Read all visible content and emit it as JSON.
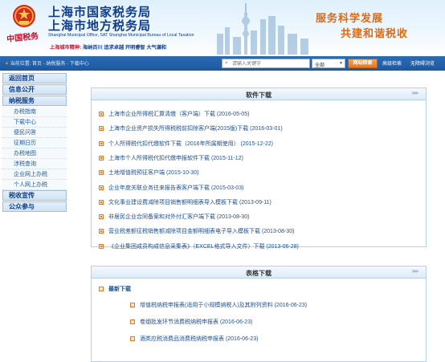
{
  "header": {
    "title_line1": "上海市国家税务局",
    "title_line2": "上海市地方税务局",
    "title_en": "Shanghai Municipal Office, SAT  Shanghai Municipal Bureau of Local Taxation",
    "spirit_label": "上海城市精神:",
    "spirit_text": "海纳百川  追求卓越  开明睿智  大气谦和",
    "seal_text": "中国税务",
    "slogan1": "服务科学发展",
    "slogan2": "共建和谐税收"
  },
  "toolbar": {
    "breadcrumb": "当前位置: 首页 - 纳税服务 - 下载中心",
    "search_placeholder": "请输入关键字",
    "scope_value": "全部",
    "search_button": "网站检索",
    "advanced_search": "高级检索",
    "accessibility": "无障碍浏览"
  },
  "sidebar": {
    "items": [
      {
        "label": "返回首页",
        "level": "main"
      },
      {
        "label": "信息公开",
        "level": "main"
      },
      {
        "label": "纳税服务",
        "level": "main"
      },
      {
        "label": "办税指南",
        "level": "sub"
      },
      {
        "label": "下载中心",
        "level": "sub"
      },
      {
        "label": "便民问答",
        "level": "sub"
      },
      {
        "label": "征期日历",
        "level": "sub"
      },
      {
        "label": "办税地图",
        "level": "sub"
      },
      {
        "label": "涉税查询",
        "level": "sub"
      },
      {
        "label": "企业网上办税",
        "level": "sub"
      },
      {
        "label": "个人网上办税",
        "level": "sub"
      },
      {
        "label": "税收宣传",
        "level": "main"
      },
      {
        "label": "公众参与",
        "level": "main"
      }
    ]
  },
  "software": {
    "title": "软件下载",
    "more": ">>>",
    "items": [
      "上海市企业所得税汇算清缴（客户端）下载 (2016-05-05)",
      "上海市企业资产损失所得税税前扣除客户端(2015版)下载 (2016-03-01)",
      "个人所得税代扣代缴软件下载（2016年所属期使用） (2015-12-22)",
      "上海市个人所得税代扣代缴申报软件下载 (2015-11-12)",
      "土地增值税预征客户端 (2015-10-30)",
      "企业年度关联业务往来报告表客户端下载 (2015-03-03)",
      "文化事业建设费减除项目销售额明细表导入模板下载 (2013-09-11)",
      "非居民企业合同备案和对外付汇客户端下载 (2013-08-30)",
      "营业税差额征税销售额减除项目金额明细表电子导入模板下载 (2013-08-30)",
      "《企业集团成员构成信息采集表》（EXCEL格式导入文件）下载 (2013-06-28)"
    ]
  },
  "forms": {
    "title": "表格下载",
    "more": ">>>",
    "newest_label": "最新下载",
    "items": [
      "增值税纳税申报表(适用于小规模纳税人)及其附列资料 (2016-06-23)",
      "卷烟批发环节消费税纳税申报表 (2016-06-23)",
      "酒类应税消费品消费税纳税申报表 (2016-06-23)"
    ]
  },
  "colors": {
    "brand_blue": "#0f3d8c",
    "accent_orange": "#e06a10",
    "link_blue": "#1f4f8e"
  }
}
